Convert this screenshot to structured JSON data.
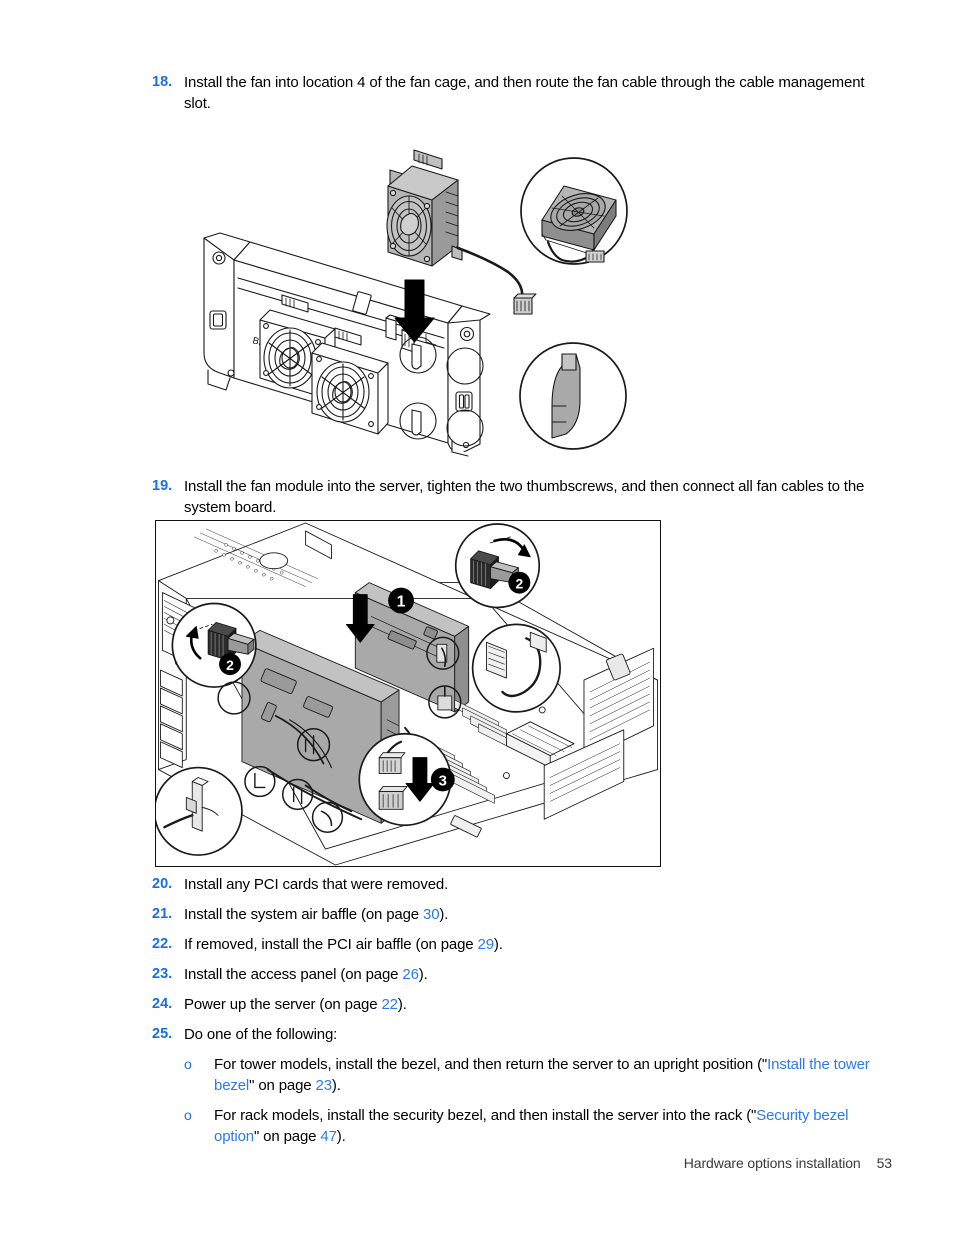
{
  "document": {
    "footer_title": "Hardware options installation",
    "page_number": "53"
  },
  "colors": {
    "step_number": "#1a6fe0",
    "cross_reference": "#2a7ae8",
    "body_text": "#000000",
    "figure_border": "#111111",
    "figure_fill": "#a9a9a9"
  },
  "steps": [
    {
      "number": "18.",
      "text": "Install the fan into location 4 of the fan cage, and then route the fan cable through the cable management slot."
    },
    {
      "number": "19.",
      "text": "Install the fan module into the server, tighten the two thumbscrews, and then connect all fan cables to the system board."
    }
  ],
  "steps_tail": [
    {
      "number": "20.",
      "text_before": "Install any PCI cards that were removed.",
      "link": "",
      "text_after": ""
    },
    {
      "number": "21.",
      "text_before": "Install the system air baffle (on page ",
      "link": "30",
      "text_after": ")."
    },
    {
      "number": "22.",
      "text_before": "If removed, install the PCI air baffle (on page ",
      "link": "29",
      "text_after": ")."
    },
    {
      "number": "23.",
      "text_before": "Install the access panel (on page ",
      "link": "26",
      "text_after": ")."
    },
    {
      "number": "24.",
      "text_before": "Power up the server (on page ",
      "link": "22",
      "text_after": ")."
    },
    {
      "number": "25.",
      "text_before": "Do one of the following:",
      "link": "",
      "text_after": ""
    }
  ],
  "sublist": {
    "bullet": "o",
    "items": [
      {
        "text_before": "For tower models, install the bezel, and then return the server to an upright position (\"",
        "link_title": "Install the tower bezel",
        "text_mid": "\" on page ",
        "link_page": "23",
        "text_after": ")."
      },
      {
        "text_before": "For rack models, install the security bezel, and then install the server into the rack (\"",
        "link_title": "Security bezel option",
        "text_mid": "\" on page ",
        "link_page": "47",
        "text_after": ")."
      }
    ]
  },
  "figure_1": {
    "caption_alt": "Installing a fan into location 4 of the fan cage with cable routed through the cable management slot",
    "callout_detail_top": "fan-with-cable-detail",
    "callout_detail_bottom": "cable-management-slot-detail",
    "arrow_label": "insertion-arrow-down"
  },
  "figure_2": {
    "caption_alt": "Installing the fan module into the server, tightening the two thumbscrews, and connecting fan cables to the system board",
    "callouts": [
      {
        "id": "1",
        "label": "1"
      },
      {
        "id": "2a",
        "label": "2"
      },
      {
        "id": "2b",
        "label": "2"
      },
      {
        "id": "3",
        "label": "3"
      }
    ]
  }
}
